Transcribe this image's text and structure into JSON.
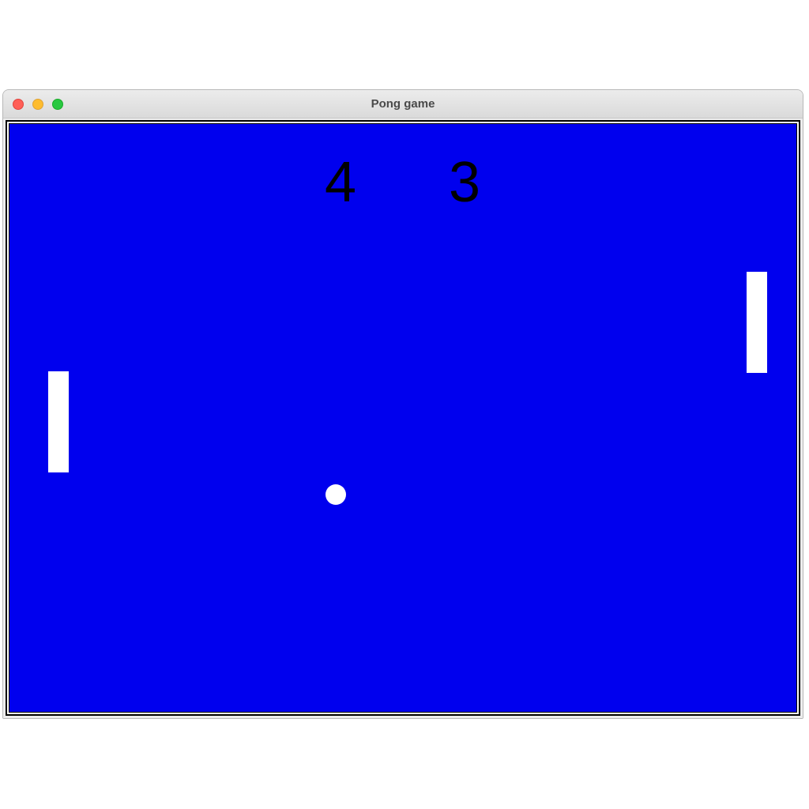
{
  "window": {
    "title": "Pong game",
    "controls": {
      "close_color": "#ff5f57",
      "minimize_color": "#febc2e",
      "zoom_color": "#28c840"
    }
  },
  "game": {
    "background_color": "#0000ee",
    "object_color": "#ffffff",
    "score": {
      "left": "4",
      "right": "3"
    }
  }
}
